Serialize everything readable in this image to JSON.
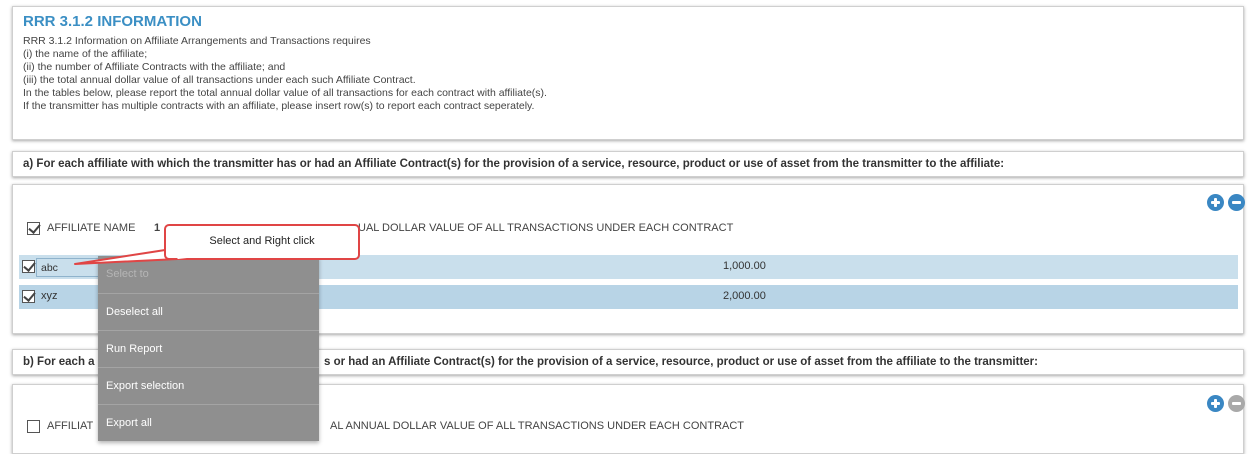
{
  "info": {
    "title": "RRR 3.1.2 INFORMATION",
    "lines": [
      "RRR 3.1.2 Information on Affiliate Arrangements and Transactions requires",
      "(i) the name of the affiliate;",
      "(ii) the number of Affiliate Contracts with the affiliate; and",
      "(iii) the total annual dollar value of all transactions under each such Affiliate Contract.",
      "In the tables below, please report the total annual dollar value of all transactions for each contract with affiliate(s).",
      "If the transmitter has multiple contracts with an affiliate, please insert row(s) to report each contract seperately."
    ]
  },
  "section_a": {
    "header": "a) For each affiliate with which the transmitter has or had an Affiliate Contract(s) for the provision of a service, resource, product or use of asset from the transmitter to the affiliate:",
    "col_name": "AFFILIATE NAME",
    "col_name_suffix": "1",
    "col_value": "UAL DOLLAR VALUE OF ALL TRANSACTIONS UNDER EACH CONTRACT",
    "rows": [
      {
        "name": "abc",
        "value": "1,000.00",
        "checked": true
      },
      {
        "name": "xyz",
        "value": "2,000.00",
        "checked": true
      }
    ]
  },
  "section_b": {
    "header_left": "b) For each a",
    "header_right": "s or had an Affiliate Contract(s) for the provision of a service, resource, product or use of asset from the affiliate to the transmitter:",
    "col_name": "AFFILIAT",
    "col_value": "AL ANNUAL DOLLAR VALUE OF ALL TRANSACTIONS UNDER EACH CONTRACT"
  },
  "context_menu": {
    "items": [
      {
        "label": "Select to",
        "disabled": true
      },
      {
        "label": "Deselect all",
        "disabled": false
      },
      {
        "label": "Run Report",
        "disabled": false
      },
      {
        "label": "Export selection",
        "disabled": false
      },
      {
        "label": "Export all",
        "disabled": false
      }
    ]
  },
  "callout": {
    "text": "Select and Right click"
  },
  "icons": {
    "add": "plus-circle-icon",
    "remove": "minus-circle-icon"
  },
  "colors": {
    "title_blue": "#3b8fc4",
    "button_blue": "#3a87c3",
    "row_highlight": "#c9dfec",
    "menu_bg": "#8f8f8f",
    "callout_border": "#e04545"
  }
}
